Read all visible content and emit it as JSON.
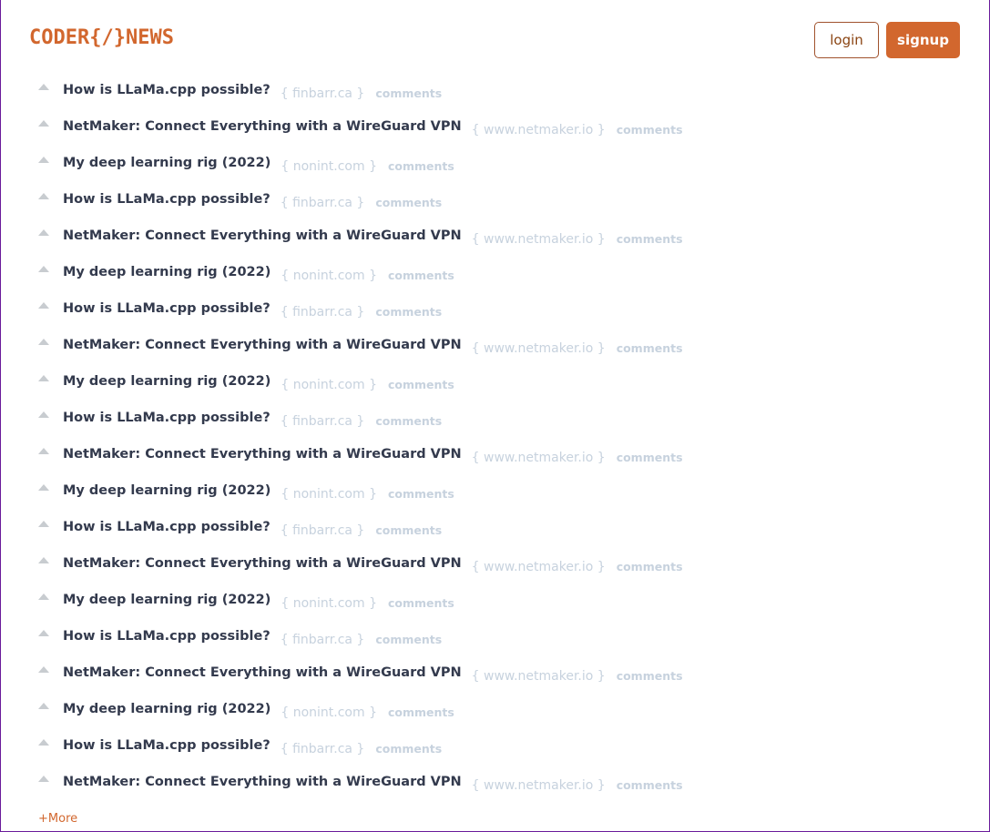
{
  "header": {
    "logo": "CODER{/}NEWS",
    "login_label": "login",
    "signup_label": "signup"
  },
  "colors": {
    "brand": "#d2672e",
    "title": "#333a4d",
    "muted": "#c7d2de"
  },
  "stories": [
    {
      "title": "How is LLaMa.cpp possible?",
      "domain": "{ finbarr.ca }",
      "comments": "comments"
    },
    {
      "title": "NetMaker: Connect Everything with a WireGuard VPN",
      "domain": "{ www.netmaker.io }",
      "comments": "comments"
    },
    {
      "title": "My deep learning rig (2022)",
      "domain": "{ nonint.com }",
      "comments": "comments"
    },
    {
      "title": "How is LLaMa.cpp possible?",
      "domain": "{ finbarr.ca }",
      "comments": "comments"
    },
    {
      "title": "NetMaker: Connect Everything with a WireGuard VPN",
      "domain": "{ www.netmaker.io }",
      "comments": "comments"
    },
    {
      "title": "My deep learning rig (2022)",
      "domain": "{ nonint.com }",
      "comments": "comments"
    },
    {
      "title": "How is LLaMa.cpp possible?",
      "domain": "{ finbarr.ca }",
      "comments": "comments"
    },
    {
      "title": "NetMaker: Connect Everything with a WireGuard VPN",
      "domain": "{ www.netmaker.io }",
      "comments": "comments"
    },
    {
      "title": "My deep learning rig (2022)",
      "domain": "{ nonint.com }",
      "comments": "comments"
    },
    {
      "title": "How is LLaMa.cpp possible?",
      "domain": "{ finbarr.ca }",
      "comments": "comments"
    },
    {
      "title": "NetMaker: Connect Everything with a WireGuard VPN",
      "domain": "{ www.netmaker.io }",
      "comments": "comments"
    },
    {
      "title": "My deep learning rig (2022)",
      "domain": "{ nonint.com }",
      "comments": "comments"
    },
    {
      "title": "How is LLaMa.cpp possible?",
      "domain": "{ finbarr.ca }",
      "comments": "comments"
    },
    {
      "title": "NetMaker: Connect Everything with a WireGuard VPN",
      "domain": "{ www.netmaker.io }",
      "comments": "comments"
    },
    {
      "title": "My deep learning rig (2022)",
      "domain": "{ nonint.com }",
      "comments": "comments"
    },
    {
      "title": "How is LLaMa.cpp possible?",
      "domain": "{ finbarr.ca }",
      "comments": "comments"
    },
    {
      "title": "NetMaker: Connect Everything with a WireGuard VPN",
      "domain": "{ www.netmaker.io }",
      "comments": "comments"
    },
    {
      "title": "My deep learning rig (2022)",
      "domain": "{ nonint.com }",
      "comments": "comments"
    },
    {
      "title": "How is LLaMa.cpp possible?",
      "domain": "{ finbarr.ca }",
      "comments": "comments"
    },
    {
      "title": "NetMaker: Connect Everything with a WireGuard VPN",
      "domain": "{ www.netmaker.io }",
      "comments": "comments"
    }
  ],
  "more_label": "+More"
}
